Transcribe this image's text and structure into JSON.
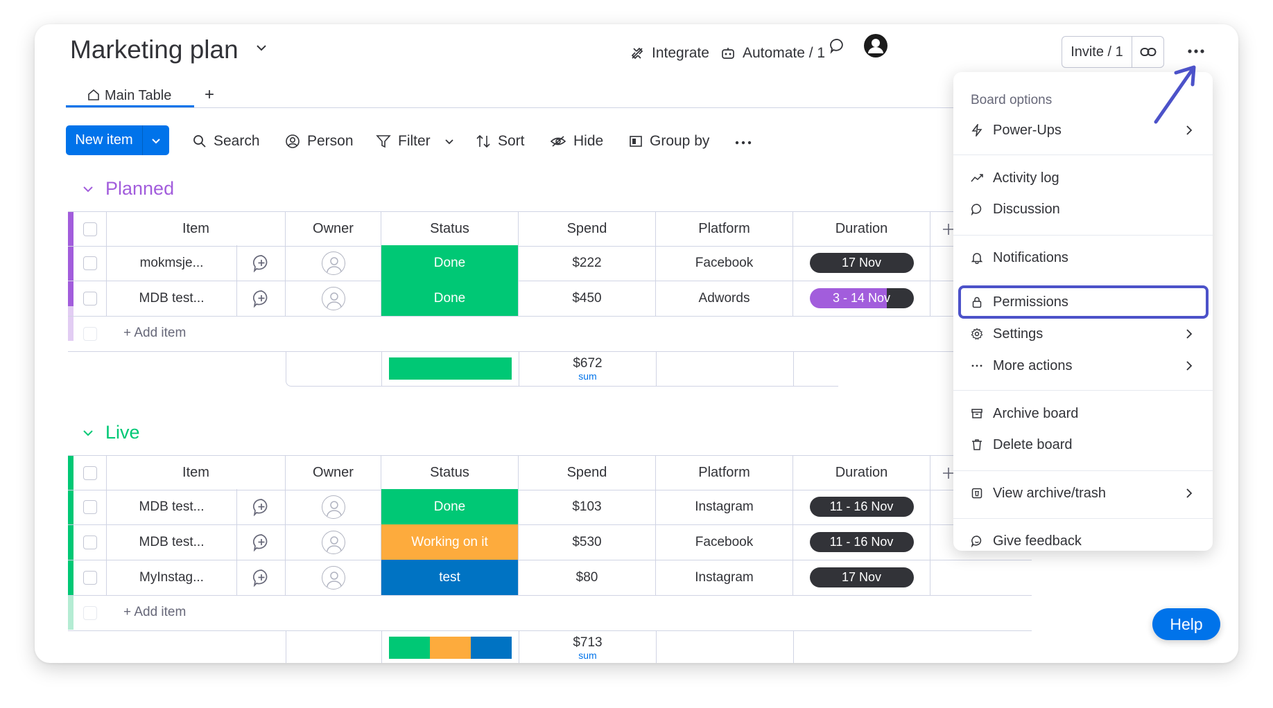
{
  "board": {
    "title": "Marketing plan"
  },
  "topbar": {
    "integrate": "Integrate",
    "automate": "Automate / 1",
    "invite": "Invite / 1"
  },
  "tabs": {
    "main": "Main Table",
    "add": "+"
  },
  "toolbar": {
    "new_item": "New item",
    "search": "Search",
    "person": "Person",
    "filter": "Filter",
    "sort": "Sort",
    "hide": "Hide",
    "group_by": "Group by"
  },
  "columns": [
    "Item",
    "Owner",
    "Status",
    "Spend",
    "Platform",
    "Duration"
  ],
  "groups": [
    {
      "name": "Planned",
      "color": "#a25ddc",
      "rows": [
        {
          "item": "mokmsje...",
          "status": "Done",
          "status_color": "#00c875",
          "spend": "$222",
          "platform": "Facebook",
          "duration": "17 Nov",
          "duration_progress": 0
        },
        {
          "item": "MDB test...",
          "status": "Done",
          "status_color": "#00c875",
          "spend": "$450",
          "platform": "Adwords",
          "duration": "3 - 14 Nov",
          "duration_progress": 0.74
        }
      ],
      "add_item": "+ Add item",
      "sum_value": "$672",
      "sum_label": "sum"
    },
    {
      "name": "Live",
      "color": "#00c875",
      "rows": [
        {
          "item": "MDB test...",
          "status": "Done",
          "status_color": "#00c875",
          "spend": "$103",
          "platform": "Instagram",
          "duration": "11 - 16 Nov"
        },
        {
          "item": "MDB test...",
          "status": "Working on it",
          "status_color": "#fdab3d",
          "spend": "$530",
          "platform": "Facebook",
          "duration": "11 - 16 Nov"
        },
        {
          "item": "MyInstag...",
          "status": "test",
          "status_color": "#0073c3",
          "spend": "$80",
          "platform": "Instagram",
          "duration": "17 Nov"
        }
      ],
      "add_item": "+ Add item",
      "sum_value": "$713",
      "sum_label": "sum"
    }
  ],
  "board_options_menu": {
    "header": "Board options",
    "items": [
      "Power-Ups",
      "Activity log",
      "Discussion",
      "Notifications",
      "Permissions",
      "Settings",
      "More actions",
      "Archive board",
      "Delete board",
      "View archive/trash",
      "Give feedback"
    ],
    "highlighted": "Permissions"
  },
  "help": "Help",
  "colors": {
    "accent": "#0073ea",
    "highlight": "#4c52c9",
    "done": "#00c875",
    "working": "#fdab3d",
    "test": "#0073c3",
    "planned": "#a25ddc"
  }
}
